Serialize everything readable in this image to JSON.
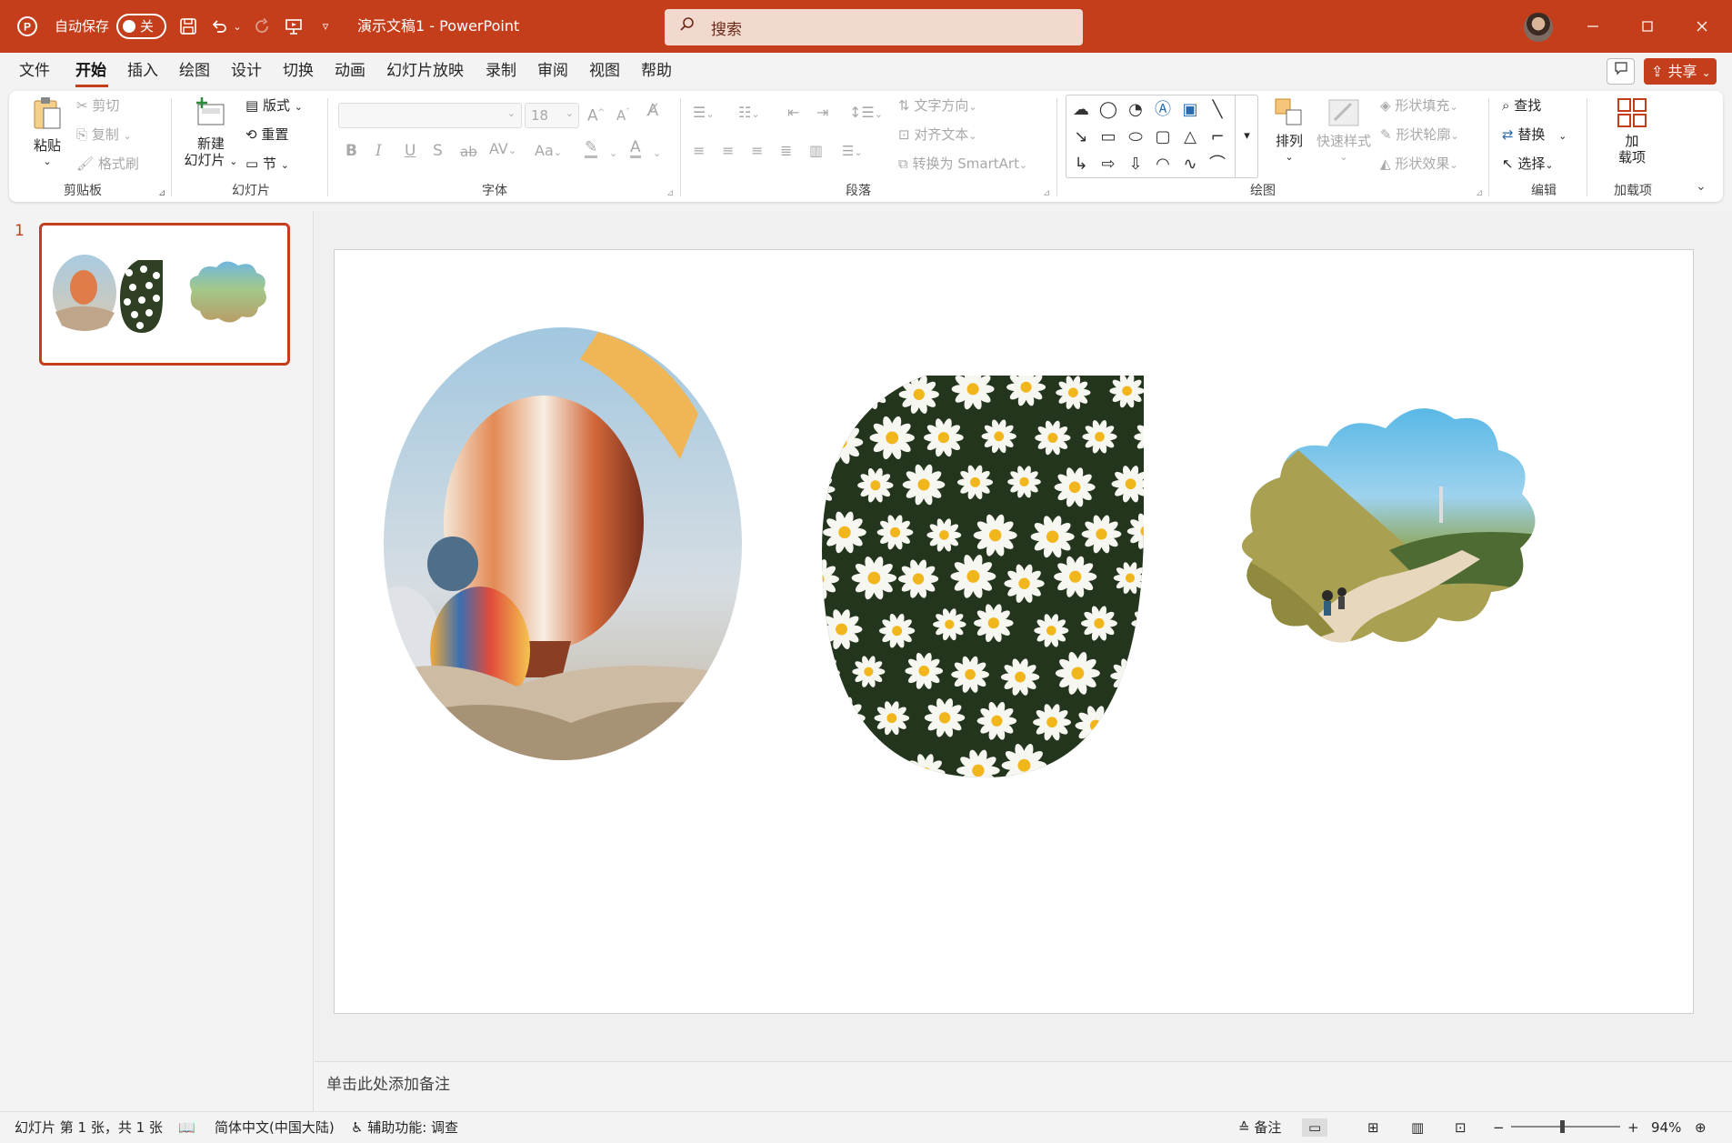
{
  "app": {
    "autosave_label": "自动保存",
    "autosave_state": "关",
    "title": "演示文稿1  -  PowerPoint",
    "search_placeholder": "搜索",
    "share": "共享"
  },
  "menu": [
    "文件",
    "开始",
    "插入",
    "绘图",
    "设计",
    "切换",
    "动画",
    "幻灯片放映",
    "录制",
    "审阅",
    "视图",
    "帮助"
  ],
  "ribbon": {
    "clipboard": {
      "paste": "粘贴",
      "cut": "剪切",
      "copy": "复制",
      "format_painter": "格式刷",
      "label": "剪贴板"
    },
    "slides": {
      "new_slide_1": "新建",
      "new_slide_2": "幻灯片",
      "layout": "版式",
      "reset": "重置",
      "section": "节",
      "label": "幻灯片"
    },
    "font": {
      "size": "18",
      "bold": "B",
      "italic": "I",
      "underline": "U",
      "shadow": "S",
      "strike": "ab",
      "case": "Aa",
      "label": "字体"
    },
    "paragraph": {
      "text_direction": "文字方向",
      "align_text": "对齐文本",
      "smartart": "转换为 SmartArt",
      "label": "段落"
    },
    "drawing": {
      "arrange": "排列",
      "quick_styles": "快速样式",
      "shape_fill": "形状填充",
      "shape_outline": "形状轮廓",
      "shape_effects": "形状效果",
      "label": "绘图"
    },
    "editing": {
      "find": "查找",
      "replace": "替换",
      "select": "选择",
      "label": "编辑"
    },
    "addins": {
      "addins_1": "加",
      "addins_2": "载项",
      "label": "加载项"
    }
  },
  "slide_panel": {
    "slide_number": "1"
  },
  "notes_placeholder": "单击此处添加备注",
  "status": {
    "slide_info": "幻灯片 第 1 张，共 1 张",
    "language": "简体中文(中国大陆)",
    "accessibility": "辅助功能: 调查",
    "notes": "备注",
    "zoom": "94%"
  },
  "colors": {
    "accent": "#c43e1c",
    "ribbon_bg": "#ffffff",
    "window_bg": "#f3f3f3"
  }
}
